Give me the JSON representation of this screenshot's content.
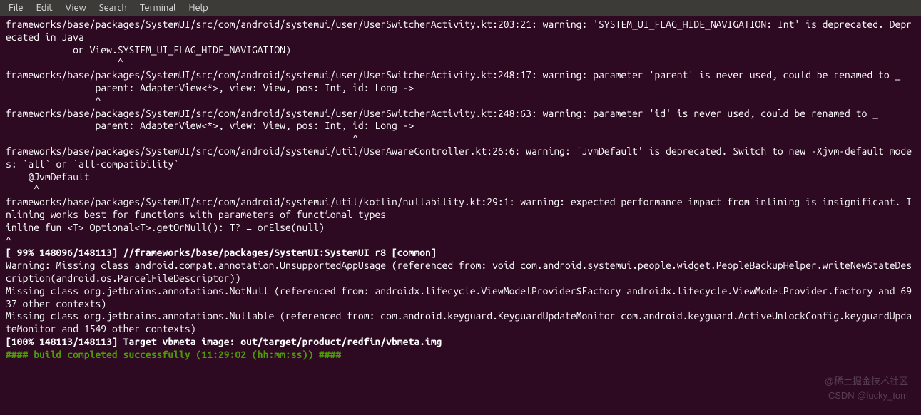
{
  "menubar": {
    "items": [
      "File",
      "Edit",
      "View",
      "Search",
      "Terminal",
      "Help"
    ]
  },
  "terminal": {
    "lines": [
      {
        "text": "frameworks/base/packages/SystemUI/src/com/android/systemui/user/UserSwitcherActivity.kt:203:21: warning: 'SYSTEM_UI_FLAG_HIDE_NAVIGATION: Int' is deprecated. Deprecated in Java"
      },
      {
        "text": "            or View.SYSTEM_UI_FLAG_HIDE_NAVIGATION)"
      },
      {
        "text": "                    ^"
      },
      {
        "text": "frameworks/base/packages/SystemUI/src/com/android/systemui/user/UserSwitcherActivity.kt:248:17: warning: parameter 'parent' is never used, could be renamed to _"
      },
      {
        "text": "                parent: AdapterView<*>, view: View, pos: Int, id: Long ->"
      },
      {
        "text": "                ^"
      },
      {
        "text": "frameworks/base/packages/SystemUI/src/com/android/systemui/user/UserSwitcherActivity.kt:248:63: warning: parameter 'id' is never used, could be renamed to _"
      },
      {
        "text": "                parent: AdapterView<*>, view: View, pos: Int, id: Long ->"
      },
      {
        "text": "                                                              ^"
      },
      {
        "text": "frameworks/base/packages/SystemUI/src/com/android/systemui/util/UserAwareController.kt:26:6: warning: 'JvmDefault' is deprecated. Switch to new -Xjvm-default modes: `all` or `all-compatibility`"
      },
      {
        "text": "    @JvmDefault"
      },
      {
        "text": "     ^"
      },
      {
        "text": "frameworks/base/packages/SystemUI/src/com/android/systemui/util/kotlin/nullability.kt:29:1: warning: expected performance impact from inlining is insignificant. Inlining works best for functions with parameters of functional types"
      },
      {
        "text": "inline fun <T> Optional<T>.getOrNull(): T? = orElse(null)"
      },
      {
        "text": "^"
      },
      {
        "text": "[ 99% 148096/148113] //frameworks/base/packages/SystemUI:SystemUI r8 [common]",
        "bold": true
      },
      {
        "text": "Warning: Missing class android.compat.annotation.UnsupportedAppUsage (referenced from: void com.android.systemui.people.widget.PeopleBackupHelper.writeNewStateDescription(android.os.ParcelFileDescriptor))"
      },
      {
        "text": "Missing class org.jetbrains.annotations.NotNull (referenced from: androidx.lifecycle.ViewModelProvider$Factory androidx.lifecycle.ViewModelProvider.factory and 6937 other contexts)"
      },
      {
        "text": "Missing class org.jetbrains.annotations.Nullable (referenced from: com.android.keyguard.KeyguardUpdateMonitor com.android.keyguard.ActiveUnlockConfig.keyguardUpdateMonitor and 1549 other contexts)"
      },
      {
        "text": "[100% 148113/148113] Target vbmeta image: out/target/product/redfin/vbmeta.img",
        "bold": true
      },
      {
        "text": ""
      },
      {
        "text": "#### build completed successfully (11:29:02 (hh:mm:ss)) ####",
        "bold": true,
        "green": true
      }
    ]
  },
  "watermark": {
    "line1": "@稀土掘金技术社区",
    "line2": "CSDN @lucky_tom"
  }
}
